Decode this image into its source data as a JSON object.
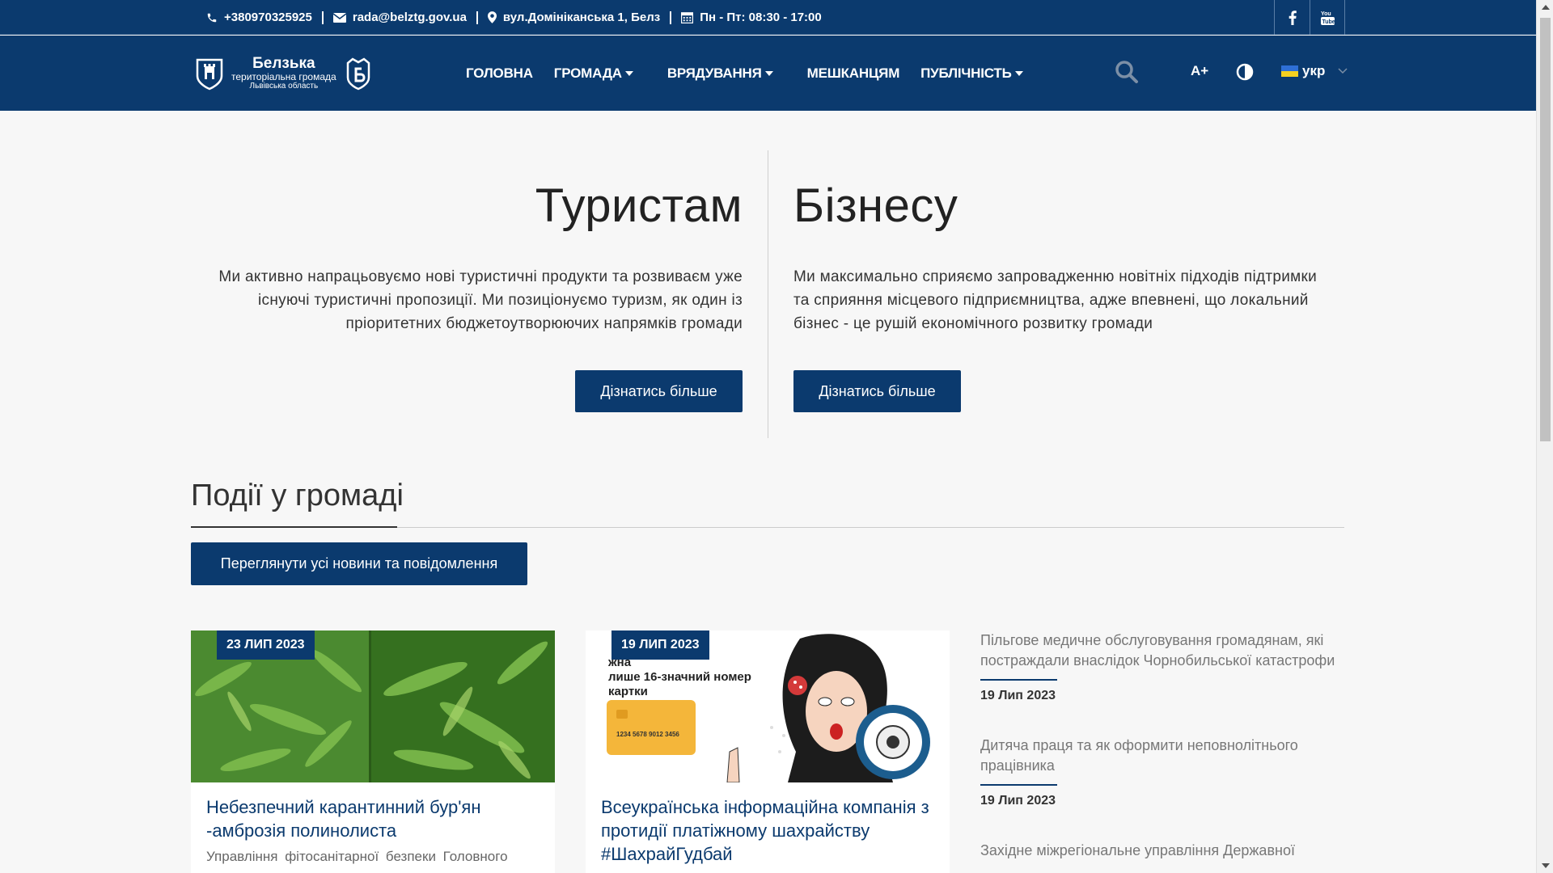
{
  "topbar": {
    "phone": "+380970325925",
    "email": "rada@belztg.gov.ua",
    "address": "вул.Домініканська 1, Белз",
    "hours": "Пн - Пт: 08:30 - 17:00"
  },
  "logo": {
    "line1": "Белзька",
    "line2": "територіальна громада",
    "line3": "Львівська область"
  },
  "nav": {
    "items": [
      {
        "label": "ГОЛОВНА"
      },
      {
        "label": "ГРОМАДА"
      },
      {
        "label": "ВРЯДУВАННЯ"
      },
      {
        "label": "МЕШКАНЦЯМ"
      },
      {
        "label": "ПУБЛІЧНІСТЬ"
      }
    ],
    "font_size_label": "A+",
    "language": "укр"
  },
  "hero": {
    "left": {
      "title": "Туристам",
      "text": "Ми активно напрацьовуємо нові туристичні продукти та розвиваєм уже існуючі туристичні пропозиції. Ми позиціонуємо туризм, як один із пріоритетних бюджетоутворюючих напрямків громади",
      "button": "Дізнатись більше"
    },
    "right": {
      "title": "Бізнесу",
      "text": "Ми максимально сприяємо запровадженню новітніх підходів підтримки та сприяння місцевого підприємництва, адже впевнені, що локальний бізнес - це рушій економічного розвитку громади",
      "button": "Дізнатись більше"
    }
  },
  "events": {
    "title": "Події у громаді",
    "all_button": "Переглянути усі новини та повідомлення",
    "cards": [
      {
        "date": "23 ЛИП 2023",
        "title": "Небезпечний карантинний бур'ян -амброзія полинолиста",
        "excerpt": "Управління фітосанітарної безпеки Головного"
      },
      {
        "date": "19 ЛИП 2023",
        "title": "Всеукраїнська інформаційна компанія з протидії платіжному шахрайству #ШахрайГудбай",
        "excerpt": "",
        "img_text_1": "жна",
        "img_text_2": "лише 16-значний номер",
        "img_text_3": "картки",
        "card_number": "1234 5678 9012 3456"
      }
    ],
    "side": [
      {
        "title": "Пільгове медичне обслуговування громадянам, які постраждали внаслідок Чорнобильської катастрофи",
        "date": "19 Лип 2023"
      },
      {
        "title": "Дитяча праця та як оформити неповнолітнього працівника",
        "date": "19 Лип 2023"
      },
      {
        "title": "Західне міжрегіональне управління Державної",
        "date": ""
      }
    ]
  }
}
